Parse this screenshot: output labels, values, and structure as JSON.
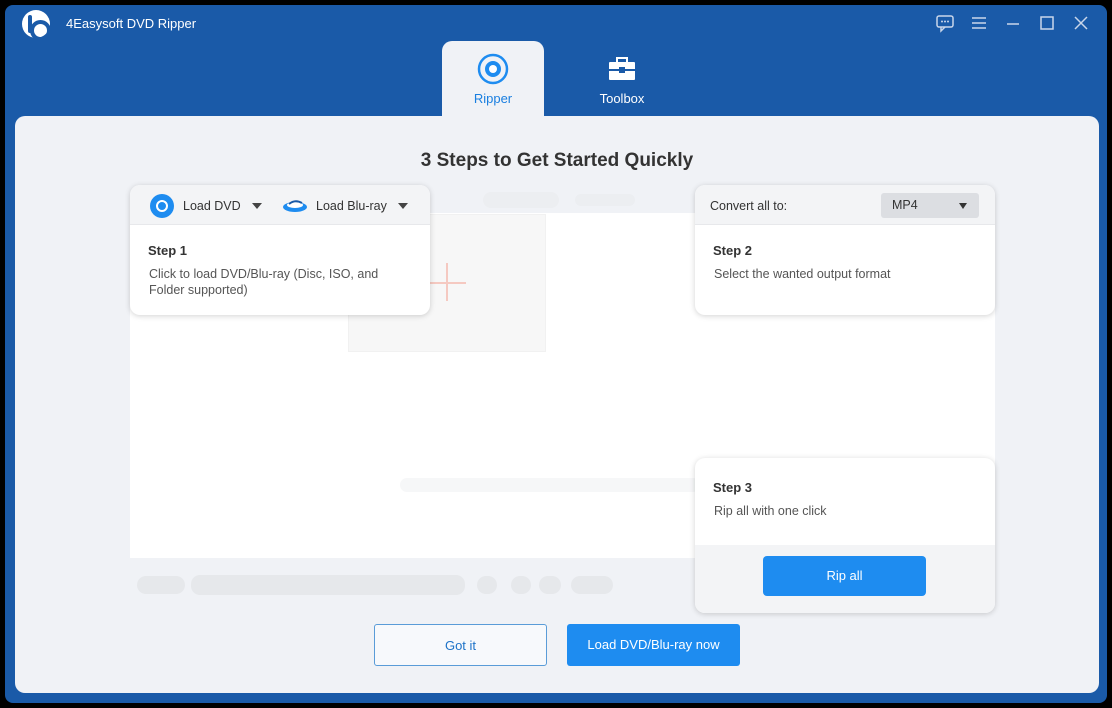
{
  "app": {
    "title": "4Easysoft DVD Ripper"
  },
  "window_controls": [
    "feedback-icon",
    "menu-icon",
    "minimize-icon",
    "maximize-icon",
    "close-icon"
  ],
  "tabs": [
    {
      "label": "Ripper",
      "icon": "ripper-icon",
      "active": true
    },
    {
      "label": "Toolbox",
      "icon": "toolbox-icon",
      "active": false
    }
  ],
  "main": {
    "title": "3 Steps to Get Started Quickly"
  },
  "step1": {
    "load_dvd": "Load DVD",
    "load_bluray": "Load Blu-ray",
    "title": "Step 1",
    "description": "Click to load DVD/Blu-ray (Disc, ISO, and Folder supported)"
  },
  "step2": {
    "convert_label": "Convert all to:",
    "format": "MP4",
    "title": "Step 2",
    "description": "Select the wanted output format"
  },
  "step3": {
    "title": "Step 3",
    "description": "Rip all with one click",
    "button": "Rip all"
  },
  "footer": {
    "got_it": "Got it",
    "load_now": "Load DVD/Blu-ray now"
  },
  "colors": {
    "brand": "#1a5aa8",
    "accent": "#1e8cf0",
    "panel": "#f0f2f6"
  }
}
